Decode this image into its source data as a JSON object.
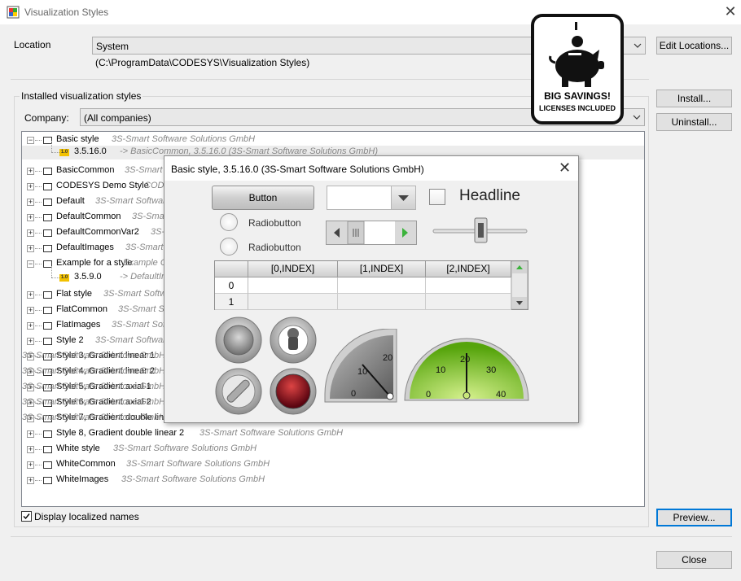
{
  "window": {
    "title": "Visualization Styles"
  },
  "location": {
    "label": "Location",
    "value": "System",
    "path": "(C:\\ProgramData\\CODESYS\\Visualization Styles)",
    "edit_button": "Edit Locations..."
  },
  "installed": {
    "group_label": "Installed visualization styles",
    "company_label": "Company:",
    "company_value": "(All companies)",
    "install_button": "Install...",
    "uninstall_button": "Uninstall..."
  },
  "tree": [
    {
      "name": "Basic style",
      "company": "3S-Smart Software Solutions GmbH",
      "expanded": true
    },
    {
      "child": true,
      "name": "3.5.16.0",
      "company": "-> BasicCommon, 3.5.16.0 (3S-Smart Software Solutions GmbH)"
    },
    {
      "name": "BasicCommon",
      "company": "3S-Smart Software Solutions GmbH"
    },
    {
      "name": "CODESYS Demo Style",
      "company": "CODESYS Development GmbH"
    },
    {
      "name": "Default",
      "company": "3S-Smart Software Solutions GmbH"
    },
    {
      "name": "DefaultCommon",
      "company": "3S-Smart Software Solutions GmbH"
    },
    {
      "name": "DefaultCommonVar2",
      "company": "3S-Smart Software Solutions GmbH"
    },
    {
      "name": "DefaultImages",
      "company": "3S-Smart Software Solutions GmbH"
    },
    {
      "name": "Example for a style",
      "company": "Example Company",
      "expanded": true
    },
    {
      "child": true,
      "name": "3.5.9.0",
      "company": "-> DefaultImages, 3.5.9.0"
    },
    {
      "name": "Flat style",
      "company": "3S-Smart Software Solutions GmbH"
    },
    {
      "name": "FlatCommon",
      "company": "3S-Smart Software Solutions GmbH"
    },
    {
      "name": "FlatImages",
      "company": "3S-Smart Software Solutions GmbH"
    },
    {
      "name": "Style 2",
      "company": "3S-Smart Software Solutions GmbH"
    },
    {
      "name": "Style 3, Gradient linear 1",
      "company": "3S-Smart Software Solutions GmbH"
    },
    {
      "name": "Style 4, Gradient linear 2",
      "company": "3S-Smart Software Solutions GmbH"
    },
    {
      "name": "Style 5, Gradient axial 1",
      "company": "3S-Smart Software Solutions GmbH"
    },
    {
      "name": "Style 6, Gradient axial 2",
      "company": "3S-Smart Software Solutions GmbH"
    },
    {
      "name": "Style 7, Gradient double linear 1",
      "company": "3S-Smart Software Solutions GmbH"
    },
    {
      "name": "Style 8, Gradient double linear 2",
      "company": "3S-Smart Software Solutions GmbH"
    },
    {
      "name": "White style",
      "company": "3S-Smart Software Solutions GmbH"
    },
    {
      "name": "WhiteCommon",
      "company": "3S-Smart Software Solutions GmbH"
    },
    {
      "name": "WhiteImages",
      "company": "3S-Smart Software Solutions GmbH"
    }
  ],
  "display_localized": {
    "label": "Display localized names",
    "checked": true
  },
  "preview_button": "Preview...",
  "close_button": "Close",
  "preview": {
    "title": "Basic style, 3.5.16.0 (3S-Smart Software Solutions GmbH)",
    "button_label": "Button",
    "radio1": "Radiobutton",
    "radio2": "Radiobutton",
    "headline": "Headline",
    "table": {
      "headers": [
        "[0,INDEX]",
        "[1,INDEX]",
        "[2,INDEX]"
      ],
      "rows": [
        "0",
        "1"
      ]
    },
    "quarter_gauge": {
      "ticks": [
        "0",
        "10",
        "20"
      ],
      "value": 10
    },
    "half_gauge": {
      "ticks": [
        "0",
        "10",
        "20",
        "30",
        "40"
      ],
      "value": 20
    },
    "colors": {
      "gauge_green": "#7cc61a",
      "lamp_red": "#8b0a1a"
    }
  },
  "promo": {
    "line1": "BIG SAVINGS!",
    "line2": "LICENSES INCLUDED",
    "icon": "piggy-bank-icon"
  }
}
